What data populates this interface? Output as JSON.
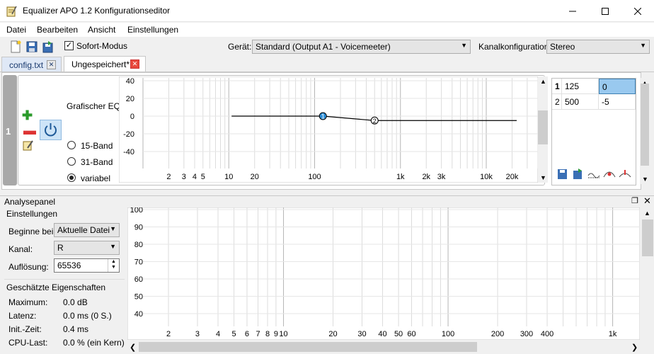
{
  "window": {
    "title": "Equalizer APO 1.2 Konfigurationseditor"
  },
  "menu": [
    "Datei",
    "Bearbeiten",
    "Ansicht",
    "Einstellungen"
  ],
  "toolbar": {
    "sofort_label": "Sofort-Modus",
    "sofort_checked": "✓",
    "geraet_label": "Gerät:",
    "geraet_value": "Standard (Output A1 - Voicemeeter)",
    "kanal_label": "Kanalkonfiguration:",
    "kanal_value": "Stereo"
  },
  "tabs": [
    {
      "label": "config.txt",
      "active": false
    },
    {
      "label": "Ungespeichert*",
      "active": true
    }
  ],
  "filter_row": {
    "index": "1",
    "type_label": "Grafischer EQ:",
    "options": [
      "15-Band",
      "31-Band",
      "variabel"
    ],
    "selected": "variabel"
  },
  "eq_graph": {
    "y_ticks": [
      "40",
      "20",
      "0",
      "-20",
      "-40"
    ],
    "x_ticks": [
      "2",
      "3",
      "4",
      "5",
      "10",
      "20",
      "100",
      "1k",
      "2k",
      "3k",
      "10k",
      "20k"
    ],
    "points": [
      {
        "label": "1",
        "freq": 125,
        "gain": 0
      },
      {
        "label": "2",
        "freq": 500,
        "gain": -5
      }
    ]
  },
  "eq_table": {
    "rows": [
      {
        "index": "1",
        "freq": "125",
        "gain": "0"
      },
      {
        "index": "2",
        "freq": "500",
        "gain": "-5"
      }
    ]
  },
  "analyse": {
    "title": "Analysepanel",
    "settings_label": "Einstellungen",
    "beginne_label": "Beginne bei:",
    "beginne_value": "Aktuelle Datei",
    "kanal_label": "Kanal:",
    "kanal_value": "R",
    "aufl_label": "Auflösung:",
    "aufl_value": "65536",
    "props_label": "Geschätzte Eigenschaften",
    "props": [
      {
        "label": "Maximum:",
        "value": "0.0 dB"
      },
      {
        "label": "Latenz:",
        "value": "0.0 ms (0 S.)"
      },
      {
        "label": "Init.-Zeit:",
        "value": "0.4 ms"
      },
      {
        "label": "CPU-Last:",
        "value": "0.0 % (ein Kern)"
      }
    ],
    "y_ticks": [
      "100",
      "90",
      "80",
      "70",
      "60",
      "50",
      "40"
    ],
    "x_ticks": [
      "2",
      "3",
      "4",
      "5",
      "6",
      "7",
      "8",
      "9",
      "10",
      "20",
      "30",
      "40",
      "50",
      "60",
      "100",
      "200",
      "300",
      "400",
      "1k"
    ]
  },
  "colors": {
    "accent": "#3c7fb1",
    "point_fill": "#2e8fd8",
    "selection": "#99c9ef"
  }
}
